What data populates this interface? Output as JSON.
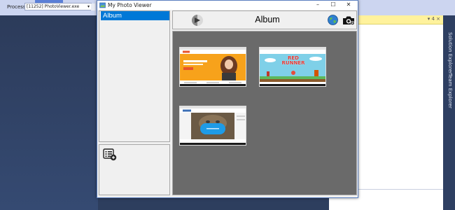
{
  "ide": {
    "process_label": "Process:",
    "process_value": "[11252] PhotoViewer.exe",
    "doc_header_controls": "▾ 4 ×",
    "right_tabs": [
      "Solution Explorer",
      "Team Explorer"
    ]
  },
  "window": {
    "title": "My Photo Viewer",
    "min_label": "–",
    "max_label": "☐",
    "close_label": "✕"
  },
  "sidebar": {
    "items": [
      {
        "label": "Album",
        "selected": true
      }
    ]
  },
  "header": {
    "title": "Album"
  },
  "gallery": {
    "thumbnails": [
      {
        "name": "Website screenshot with woman"
      },
      {
        "name": "Red Runner game screenshot",
        "label": "RED RUNNER"
      },
      {
        "name": "Cat video screenshot"
      }
    ]
  },
  "colors": {
    "accent": "#0078d7",
    "gallery_bg": "#6a6a6a"
  }
}
